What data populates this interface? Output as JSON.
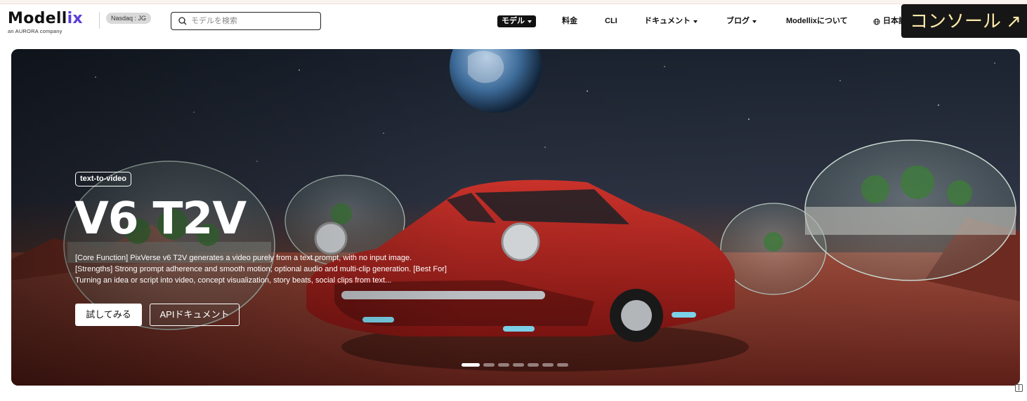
{
  "header": {
    "logo_text_main": "Modell",
    "logo_text_accent": "ix",
    "logo_sub": "an AURORA company",
    "ticker": "Nasdaq : JG",
    "search_placeholder": "モデルを検索",
    "nav": [
      {
        "label": "モデル",
        "dropdown": true,
        "active": true
      },
      {
        "label": "料金",
        "dropdown": false
      },
      {
        "label": "CLI",
        "dropdown": false
      },
      {
        "label": "ドキュメント",
        "dropdown": true
      },
      {
        "label": "ブログ",
        "dropdown": true
      },
      {
        "label": "Modellixについて",
        "dropdown": false
      }
    ],
    "language": "日本語",
    "console_label": "コンソール ↗"
  },
  "hero": {
    "tag": "text-to-video",
    "title": "V6 T2V",
    "description": "[Core Function] PixVerse v6 T2V generates a video purely from a text prompt, with no input image. [Strengths] Strong prompt adherence and smooth motion; optional audio and multi-clip generation. [Best For] Turning an idea or script into video, concept visualization, story beats, social clips from text...",
    "primary_button": "試してみる",
    "secondary_button": "APIドキュメント",
    "carousel_count": 7,
    "carousel_active": 0
  },
  "colors": {
    "accent": "#5b3fd6",
    "console_bg": "#161616",
    "console_text": "#ffe9a8"
  }
}
